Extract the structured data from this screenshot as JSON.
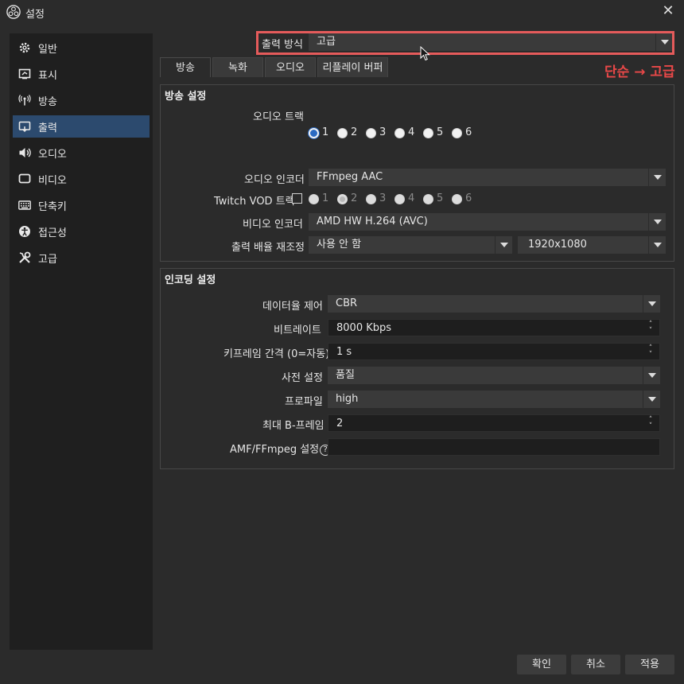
{
  "window": {
    "title": "설정"
  },
  "sidebar": {
    "items": [
      {
        "label": "일반",
        "icon": "gear-icon"
      },
      {
        "label": "표시",
        "icon": "display-icon"
      },
      {
        "label": "방송",
        "icon": "broadcast-icon"
      },
      {
        "label": "출력",
        "icon": "output-icon",
        "active": true
      },
      {
        "label": "오디오",
        "icon": "speaker-icon"
      },
      {
        "label": "비디오",
        "icon": "monitor-icon"
      },
      {
        "label": "단축키",
        "icon": "keyboard-icon"
      },
      {
        "label": "접근성",
        "icon": "accessibility-icon"
      },
      {
        "label": "고급",
        "icon": "tools-icon"
      }
    ]
  },
  "output_mode": {
    "label": "출력 방식",
    "value": "고급"
  },
  "annotation": {
    "text": "단순 → 고급",
    "color": "#e94848"
  },
  "tabs": [
    {
      "label": "방송",
      "active": true
    },
    {
      "label": "녹화"
    },
    {
      "label": "오디오"
    },
    {
      "label": "리플레이 버퍼"
    }
  ],
  "streaming": {
    "title": "방송 설정",
    "audio_track_label": "오디오 트랙",
    "audio_tracks": [
      "1",
      "2",
      "3",
      "4",
      "5",
      "6"
    ],
    "audio_track_selected": "1",
    "audio_encoder_label": "오디오 인코더",
    "audio_encoder_value": "FFmpeg AAC",
    "twitch_vod_label": "Twitch VOD 트랙",
    "twitch_tracks": [
      "1",
      "2",
      "3",
      "4",
      "5",
      "6"
    ],
    "twitch_track_selected": "2",
    "video_encoder_label": "비디오 인코더",
    "video_encoder_value": "AMD HW H.264 (AVC)",
    "rescale_label": "출력 배율 재조정",
    "rescale_value": "사용 안 함",
    "rescale_resolution": "1920x1080"
  },
  "encoder": {
    "title": "인코딩 설정",
    "rate_control_label": "데이터율 제어",
    "rate_control_value": "CBR",
    "bitrate_label": "비트레이트",
    "bitrate_value": "8000 Kbps",
    "keyframe_label": "키프레임 간격 (0=자동)",
    "keyframe_value": "1 s",
    "preset_label": "사전 설정",
    "preset_value": "품질",
    "profile_label": "프로파일",
    "profile_value": "high",
    "bframes_label": "최대 B-프레임",
    "bframes_value": "2",
    "amf_label": "AMF/FFmpeg 설정",
    "amf_value": ""
  },
  "buttons": {
    "ok": "확인",
    "cancel": "취소",
    "apply": "적용"
  },
  "colors": {
    "accent": "#2a6ac3",
    "sidebar_active": "#2c4a6e",
    "highlight": "#e55b5b"
  }
}
